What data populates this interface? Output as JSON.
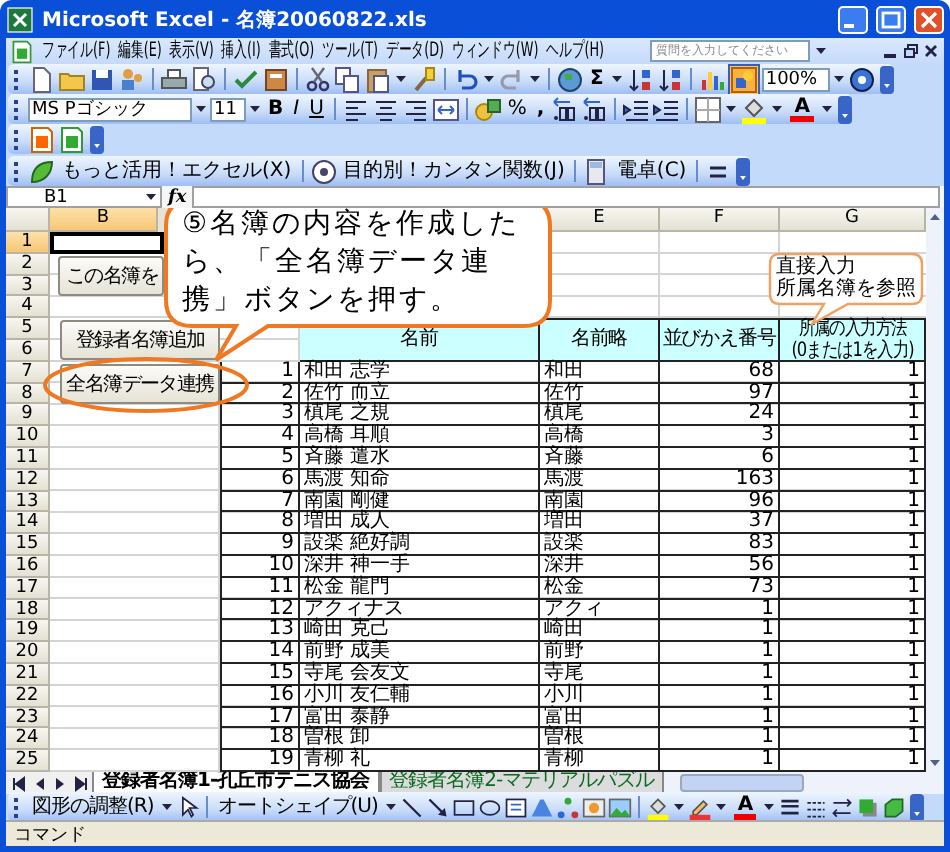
{
  "window": {
    "title": "Microsoft Excel - 名簿20060822.xls"
  },
  "menu": [
    "ファイル(F)",
    "編集(E)",
    "表示(V)",
    "挿入(I)",
    "書式(O)",
    "ツール(T)",
    "データ(D)",
    "ウィンドウ(W)",
    "ヘルプ(H)"
  ],
  "help_box": {
    "placeholder": "質問を入力してください"
  },
  "standard_toolbar": {
    "sum": "Σ",
    "zoom": "100%"
  },
  "format_toolbar": {
    "font": "MS Pゴシック",
    "size": "11",
    "bold": "B",
    "italic": "I",
    "underline": "U",
    "percent": "%",
    "comma": ",",
    "font_color": "A"
  },
  "custom_toolbar": [
    "もっと活用！エクセル(X)",
    "目的別！カンタン関数(J)",
    "電卓(C)"
  ],
  "formula_bar": {
    "name_box": "B1",
    "fx": "fx"
  },
  "column_headers": [
    {
      "label": "B",
      "selected": true
    },
    {
      "label": "E",
      "selected": false
    },
    {
      "label": "F",
      "selected": false
    },
    {
      "label": "G",
      "selected": false
    }
  ],
  "row_headers": [
    {
      "label": "1",
      "selected": true
    },
    {
      "label": "2",
      "selected": false
    },
    {
      "label": "3",
      "selected": false
    },
    {
      "label": "4",
      "selected": false
    },
    {
      "label": "5",
      "selected": false
    },
    {
      "label": "6",
      "selected": false
    },
    {
      "label": "7",
      "selected": false
    },
    {
      "label": "8",
      "selected": false
    },
    {
      "label": "9",
      "selected": false
    },
    {
      "label": "10",
      "selected": false
    },
    {
      "label": "11",
      "selected": false
    },
    {
      "label": "12",
      "selected": false
    },
    {
      "label": "13",
      "selected": false
    },
    {
      "label": "14",
      "selected": false
    },
    {
      "label": "15",
      "selected": false
    },
    {
      "label": "16",
      "selected": false
    },
    {
      "label": "17",
      "selected": false
    },
    {
      "label": "18",
      "selected": false
    },
    {
      "label": "19",
      "selected": false
    },
    {
      "label": "20",
      "selected": false
    },
    {
      "label": "21",
      "selected": false
    },
    {
      "label": "22",
      "selected": false
    },
    {
      "label": "23",
      "selected": false
    },
    {
      "label": "24",
      "selected": false
    },
    {
      "label": "25",
      "selected": false
    }
  ],
  "sheet_buttons": [
    "この名簿を",
    "登録者名簿追加",
    "全名簿データ連携"
  ],
  "table": {
    "columns": [
      "",
      "名前",
      "名前略",
      "並びかえ番号",
      "所属の入力方法(0または1を入力)"
    ],
    "rows": [
      [
        "1",
        "和田 志学",
        "和田",
        "68",
        "1"
      ],
      [
        "2",
        "佐竹 而立",
        "佐竹",
        "97",
        "1"
      ],
      [
        "3",
        "槙尾 之規",
        "槙尾",
        "24",
        "1"
      ],
      [
        "4",
        "高橋 耳順",
        "高橋",
        "3",
        "1"
      ],
      [
        "5",
        "斉藤 遣水",
        "斉藤",
        "6",
        "1"
      ],
      [
        "6",
        "馬渡 知命",
        "馬渡",
        "163",
        "1"
      ],
      [
        "7",
        "南園 剛健",
        "南園",
        "96",
        "1"
      ],
      [
        "8",
        "増田 成人",
        "増田",
        "37",
        "1"
      ],
      [
        "9",
        "設楽 絶好調",
        "設楽",
        "83",
        "1"
      ],
      [
        "10",
        "深井 神一手",
        "深井",
        "56",
        "1"
      ],
      [
        "11",
        "松金 龍門",
        "松金",
        "73",
        "1"
      ],
      [
        "12",
        "アクィナス",
        "アクィ",
        "1",
        "1"
      ],
      [
        "13",
        "崎田 克己",
        "崎田",
        "1",
        "1"
      ],
      [
        "14",
        "前野 成美",
        "前野",
        "1",
        "1"
      ],
      [
        "15",
        "寺尾 会友文",
        "寺尾",
        "1",
        "1"
      ],
      [
        "16",
        "小川 友仁輔",
        "小川",
        "1",
        "1"
      ],
      [
        "17",
        "富田 泰静",
        "富田",
        "1",
        "1"
      ],
      [
        "18",
        "曽根 卸",
        "曽根",
        "1",
        "1"
      ],
      [
        "19",
        "青柳 礼",
        "青柳",
        "1",
        "1"
      ]
    ]
  },
  "callouts": [
    {
      "text": "⑤名簿の内容を作成したら、「全名簿データ連携」ボタンを押す。"
    },
    {
      "lines": [
        "直接入力",
        "所属名簿を参照"
      ]
    }
  ],
  "sheet_tabs": [
    {
      "label": "登録者名簿1-孔丘市テニス協会",
      "selected": true
    },
    {
      "label": "登録者名簿2-マテリアルパズル",
      "selected": false
    }
  ],
  "drawing_toolbar": {
    "items": [
      "図形の調整(R)",
      "オートシェイプ(U)"
    ],
    "font_color": "A"
  },
  "status_bar": "コマンド"
}
